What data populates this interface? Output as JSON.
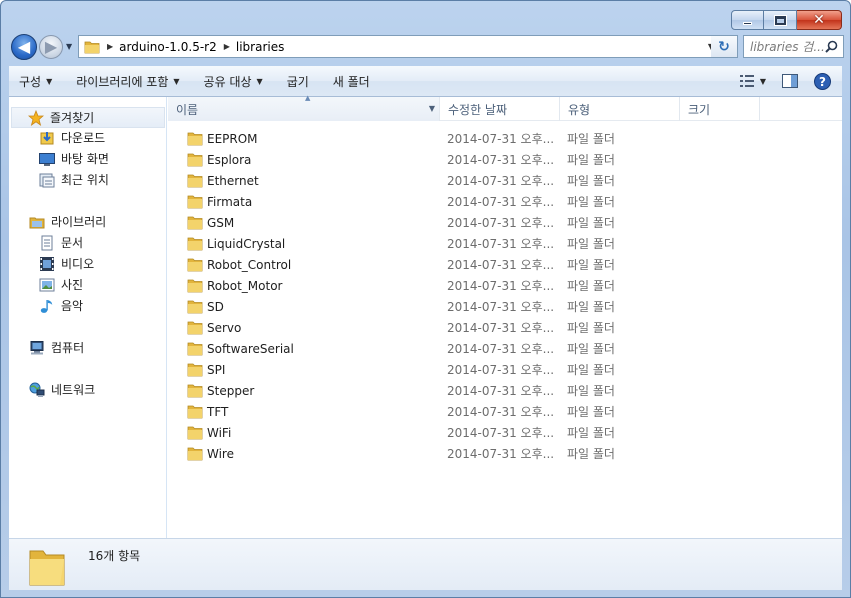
{
  "window": {
    "buttons": {
      "minimize": "minimize-icon",
      "maximize": "maximize-icon",
      "close": "close-icon"
    }
  },
  "address_bar": {
    "crumbs": [
      "arduino-1.0.5-r2",
      "libraries"
    ]
  },
  "search": {
    "placeholder": "libraries 검..."
  },
  "toolbar": {
    "organize": "구성",
    "include_in_library": "라이브러리에 포함",
    "share_with": "공유 대상",
    "burn": "굽기",
    "new_folder": "새 폴더"
  },
  "sidebar": {
    "favorites": {
      "label": "즐겨찾기",
      "items": [
        {
          "label": "다운로드",
          "icon": "downloads-icon"
        },
        {
          "label": "바탕 화면",
          "icon": "desktop-icon"
        },
        {
          "label": "최근 위치",
          "icon": "recent-places-icon"
        }
      ]
    },
    "libraries": {
      "label": "라이브러리",
      "items": [
        {
          "label": "문서",
          "icon": "documents-icon"
        },
        {
          "label": "비디오",
          "icon": "videos-icon"
        },
        {
          "label": "사진",
          "icon": "pictures-icon"
        },
        {
          "label": "음악",
          "icon": "music-icon"
        }
      ]
    },
    "computer": {
      "label": "컴퓨터"
    },
    "network": {
      "label": "네트워크"
    }
  },
  "columns": {
    "name": "이름",
    "date": "수정한 날짜",
    "type": "유형",
    "size": "크기"
  },
  "files": [
    {
      "name": "EEPROM",
      "date": "2014-07-31 오후...",
      "type": "파일 폴더"
    },
    {
      "name": "Esplora",
      "date": "2014-07-31 오후...",
      "type": "파일 폴더"
    },
    {
      "name": "Ethernet",
      "date": "2014-07-31 오후...",
      "type": "파일 폴더"
    },
    {
      "name": "Firmata",
      "date": "2014-07-31 오후...",
      "type": "파일 폴더"
    },
    {
      "name": "GSM",
      "date": "2014-07-31 오후...",
      "type": "파일 폴더"
    },
    {
      "name": "LiquidCrystal",
      "date": "2014-07-31 오후...",
      "type": "파일 폴더"
    },
    {
      "name": "Robot_Control",
      "date": "2014-07-31 오후...",
      "type": "파일 폴더"
    },
    {
      "name": "Robot_Motor",
      "date": "2014-07-31 오후...",
      "type": "파일 폴더"
    },
    {
      "name": "SD",
      "date": "2014-07-31 오후...",
      "type": "파일 폴더"
    },
    {
      "name": "Servo",
      "date": "2014-07-31 오후...",
      "type": "파일 폴더"
    },
    {
      "name": "SoftwareSerial",
      "date": "2014-07-31 오후...",
      "type": "파일 폴더"
    },
    {
      "name": "SPI",
      "date": "2014-07-31 오후...",
      "type": "파일 폴더"
    },
    {
      "name": "Stepper",
      "date": "2014-07-31 오후...",
      "type": "파일 폴더"
    },
    {
      "name": "TFT",
      "date": "2014-07-31 오후...",
      "type": "파일 폴더"
    },
    {
      "name": "WiFi",
      "date": "2014-07-31 오후...",
      "type": "파일 폴더"
    },
    {
      "name": "Wire",
      "date": "2014-07-31 오후...",
      "type": "파일 폴더"
    }
  ],
  "details": {
    "count": "16개 항목"
  },
  "colors": {
    "accent": "#2b6ac8",
    "folder": "#f3c94f",
    "frame": "#a9c4e6"
  }
}
